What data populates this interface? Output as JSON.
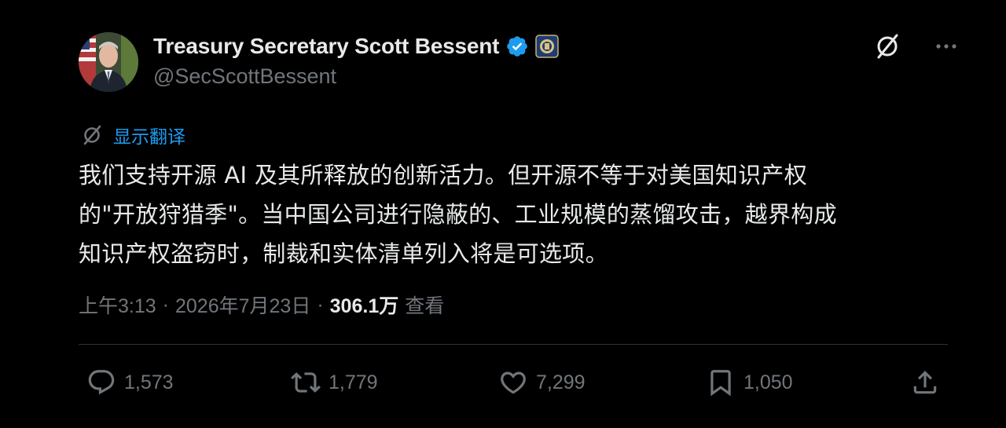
{
  "author": {
    "display_name": "Treasury Secretary Scott Bessent",
    "handle": "@SecScottBessent",
    "verified": true,
    "affiliate_badge": "treasury-seal-icon"
  },
  "translate": {
    "label": "显示翻译",
    "icon": "grok-translate-icon"
  },
  "tweet": {
    "lines": [
      "我们支持开源 AI 及其所释放的创新活力。但开源不等于对美国知识产权",
      "的\"开放狩猎季\"。当中国公司进行隐蔽的、工业规模的蒸馏攻击，越界构成",
      "知识产权盗窃时，制裁和实体清单列入将是可选项。"
    ]
  },
  "meta": {
    "time": "上午3:13",
    "separator": "·",
    "date": "2026年7月23日",
    "views_count": "306.1万",
    "views_label": "查看"
  },
  "actions": {
    "replies": "1,573",
    "retweets": "1,779",
    "likes": "7,299",
    "bookmarks": "1,050"
  },
  "colors": {
    "background": "#000000",
    "text": "#e7e9ea",
    "secondary": "#71767b",
    "link": "#1d9bf0",
    "verified": "#1d9bf0",
    "divider": "#2f3336"
  }
}
